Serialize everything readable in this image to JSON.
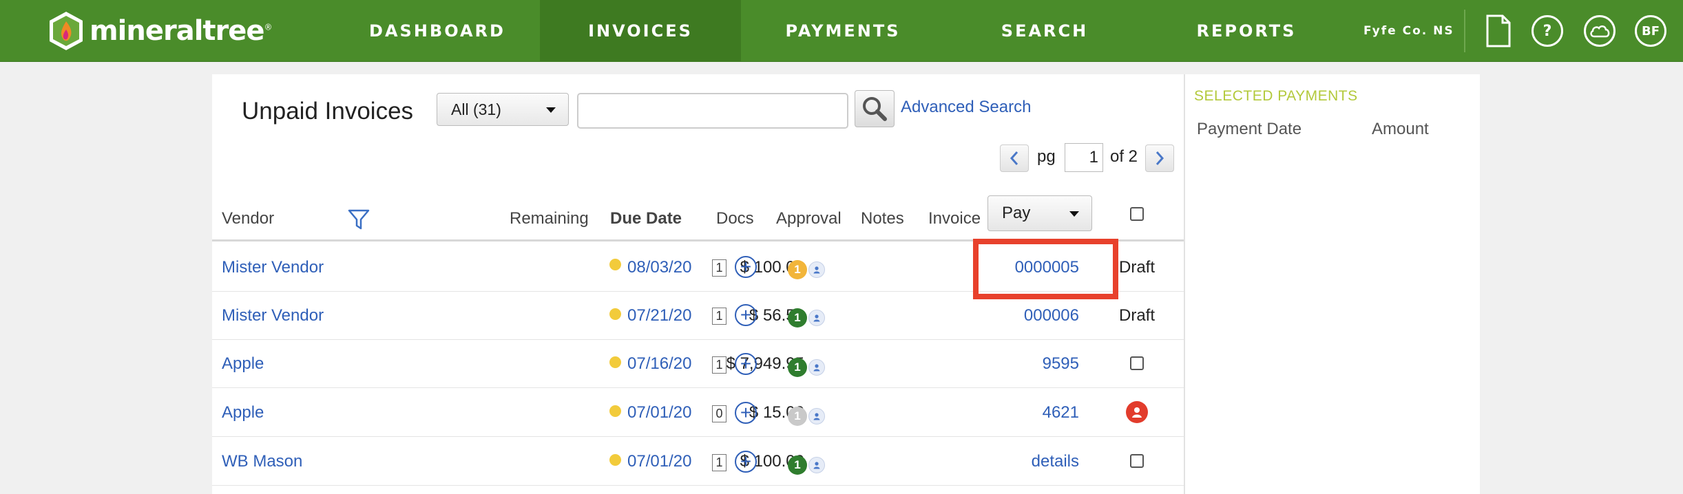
{
  "nav": {
    "logo_text": "mineraltree",
    "logo_mark": "®",
    "items": [
      "DASHBOARD",
      "INVOICES",
      "PAYMENTS",
      "SEARCH",
      "REPORTS"
    ],
    "active": "INVOICES",
    "org_name": "Fyfe Co. NS",
    "help_symbol": "?",
    "user_initials": "BF"
  },
  "toolbar": {
    "title": "Unpaid Invoices",
    "filter_value": "All (31)",
    "search_value": "",
    "advanced_search_label": "Advanced Search"
  },
  "pager": {
    "pg_label": "pg",
    "current_page": "1",
    "of_label": "of 2"
  },
  "table": {
    "headers": {
      "vendor": "Vendor",
      "remaining": "Remaining",
      "due_date": "Due Date",
      "docs": "Docs",
      "approval": "Approval",
      "notes": "Notes",
      "invoice": "Invoice",
      "pay": "Pay"
    },
    "rows": [
      {
        "vendor": "Mister Vendor",
        "remaining": "$ 100.00",
        "due_date": "08/03/20",
        "docs": "1",
        "approval_count": "1",
        "approval_color": "#f2b53a",
        "invoice": "0000005",
        "status": "Draft"
      },
      {
        "vendor": "Mister Vendor",
        "remaining": "$ 56.50",
        "due_date": "07/21/20",
        "docs": "1",
        "approval_count": "1",
        "approval_color": "#2f7d2e",
        "invoice": "000006",
        "status": "Draft"
      },
      {
        "vendor": "Apple",
        "remaining": "$ 7,949.95",
        "due_date": "07/16/20",
        "docs": "1",
        "approval_count": "1",
        "approval_color": "#2f7d2e",
        "invoice": "9595",
        "status": ""
      },
      {
        "vendor": "Apple",
        "remaining": "$ 15.00",
        "due_date": "07/01/20",
        "docs": "0",
        "approval_count": "1",
        "approval_color": "#c9c9c9",
        "invoice": "4621",
        "status": ""
      },
      {
        "vendor": "WB Mason",
        "remaining": "$ 100.00",
        "due_date": "07/01/20",
        "docs": "1",
        "approval_count": "1",
        "approval_color": "#2f7d2e",
        "invoice": "details",
        "status": ""
      }
    ]
  },
  "selected_payments": {
    "title": "SELECTED PAYMENTS",
    "col_date": "Payment Date",
    "col_amount": "Amount"
  },
  "colors": {
    "nav_green": "#4a8c2a",
    "link_blue": "#2f5fb8",
    "highlight_red": "#e8412c",
    "selected_payments_title": "#b3c93b"
  }
}
